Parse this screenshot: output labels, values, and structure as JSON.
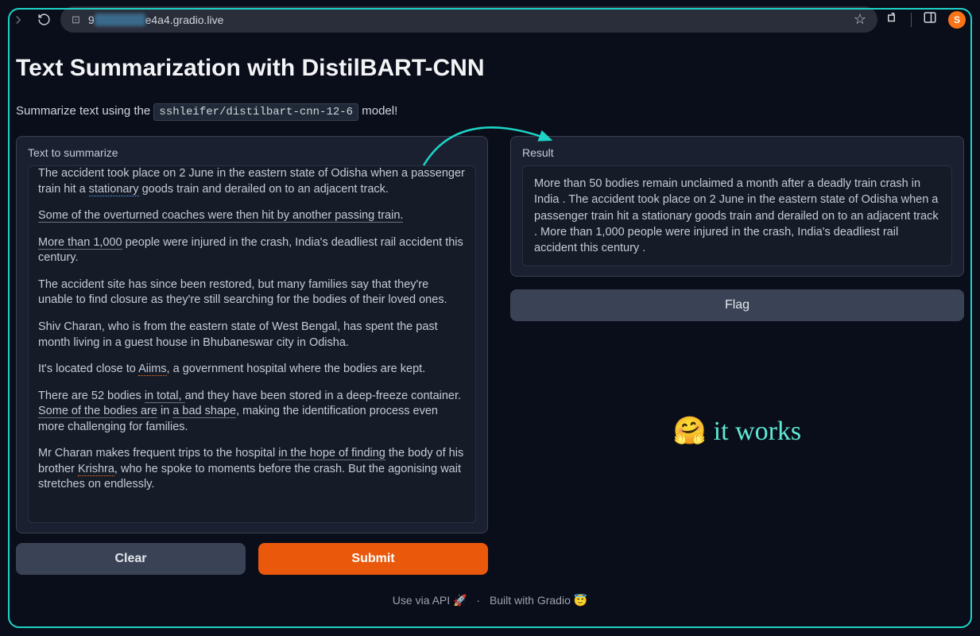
{
  "browser": {
    "url_prefix": "9",
    "url_suffix": "e4a4.gradio.live",
    "profile_letter": "S"
  },
  "header": {
    "title": "Text Summarization with DistilBART-CNN",
    "subtitle_prefix": "Summarize text using the ",
    "model_name": "sshleifer/distilbart-cnn-12-6",
    "subtitle_suffix": " model!"
  },
  "input": {
    "label": "Text to summarize",
    "p1_a": "The accident took place on 2 June in the eastern state of Odisha when a passenger train hit a ",
    "p1_b": "stationary",
    "p1_c": " goods train and derailed on to an adjacent track.",
    "p2": "Some of the overturned coaches were then hit by another passing train.",
    "p3_a": "More than 1,000",
    "p3_b": " people were injured in the crash, India's deadliest rail accident this century.",
    "p4": "The accident site has since been restored, but many families say that they're unable to find closure as they're still searching for the bodies of their loved ones.",
    "p5": "Shiv Charan, who is from the eastern state of West Bengal, has spent the past month living in a guest house in Bhubaneswar city in Odisha.",
    "p6_a": "It's located close to ",
    "p6_b": "Aiims",
    "p6_c": ", a government hospital where the bodies are kept.",
    "p7_a": "There are 52 bodies ",
    "p7_b": "in total, ",
    "p7_c": "and they have been stored in a deep-freeze container. ",
    "p7_d": "Some of the bodies are",
    "p7_e": " in ",
    "p7_f": "a bad shape",
    "p7_g": ", making the identification process even more challenging for families.",
    "p8_a": "Mr Charan makes frequent trips to the hospital ",
    "p8_b": "in the hope of finding",
    "p8_c": " the body of his brother ",
    "p8_d": "Krishra",
    "p8_e": ", who he spoke to moments before the crash. But the agonising wait stretches on endlessly."
  },
  "buttons": {
    "clear": "Clear",
    "submit": "Submit",
    "flag": "Flag"
  },
  "output": {
    "label": "Result",
    "text": " More than 50 bodies remain unclaimed a month after a deadly train crash in India . The accident took place on 2 June in the eastern state of Odisha when a passenger train hit a stationary goods train and derailed on to an adjacent track . More than 1,000 people were injured in the crash, India's deadliest rail accident this century ."
  },
  "annotation": {
    "text": "🤗 it works"
  },
  "footer": {
    "api": "Use via API 🚀",
    "built": "Built with Gradio 😇"
  }
}
